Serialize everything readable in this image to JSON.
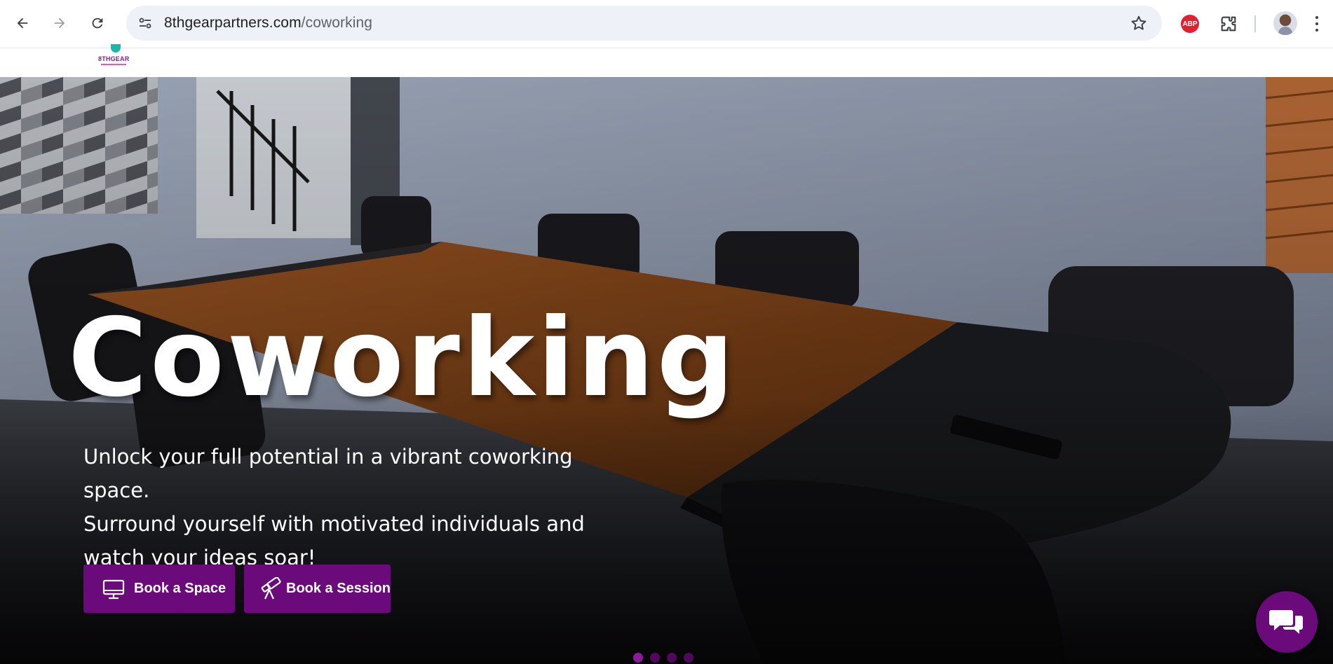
{
  "browser": {
    "url_host": "8thgearpartners.com",
    "url_path": "/coworking",
    "extension_abp_label": "ABP"
  },
  "site": {
    "logo_text": "8THGEAR"
  },
  "hero": {
    "title": "Coworking",
    "subtitle_lines": [
      "Unlock your full potential in a vibrant coworking space.",
      "Surround yourself with motivated individuals and",
      "watch your ideas soar!"
    ],
    "buttons": {
      "book_space": "Book a Space",
      "book_session": "Book a Session"
    },
    "slider": {
      "slide_count": 4,
      "active_index": 0
    }
  },
  "colors": {
    "brand_purple": "#6b0a7a",
    "omnibox_bg": "#eef1f7",
    "abp_red": "#e3202f"
  },
  "icons": {
    "back": "arrow-left-icon",
    "forward": "arrow-right-icon",
    "reload": "reload-icon",
    "site_info": "tune-icon",
    "bookmark": "star-icon",
    "extensions": "puzzle-icon",
    "menu": "kebab-menu-icon",
    "book_space": "monitor-icon",
    "book_session": "telescope-icon",
    "chat": "chat-bubbles-icon"
  }
}
